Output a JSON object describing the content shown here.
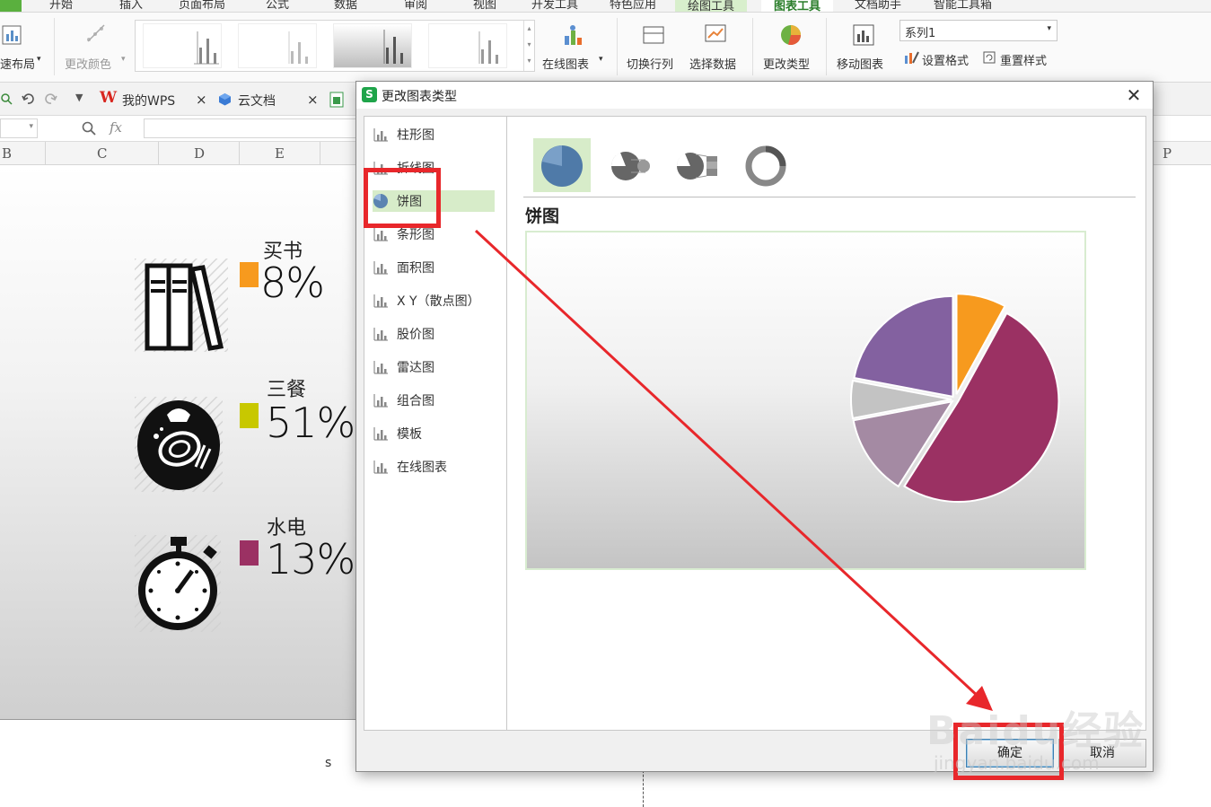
{
  "ribbon": {
    "tabs": [
      "开始",
      "插入",
      "页面布局",
      "公式",
      "数据",
      "审阅",
      "视图",
      "开发工具",
      "特色应用",
      "绘图工具",
      "图表工具",
      "文档助手",
      "智能工具箱"
    ],
    "active_tab": "图表工具",
    "quick_layout_label": "速布局",
    "change_color_label": "更改颜色",
    "online_chart_label": "在线图表",
    "switch_rowcol_label": "切换行列",
    "select_data_label": "选择数据",
    "change_type_label": "更改类型",
    "move_chart_label": "移动图表",
    "series_select_value": "系列1",
    "format_label": "设置格式",
    "reset_style_label": "重置样式"
  },
  "doc_tabs": {
    "my_wps": "我的WPS",
    "cloud_docs": "云文档"
  },
  "formula_bar": {
    "fx": "fx"
  },
  "columns": [
    "B",
    "C",
    "D",
    "E",
    "P"
  ],
  "sheet": {
    "items": [
      {
        "label": "买书",
        "percent": "8%",
        "color": "#f79a1e",
        "icon": "books-icon"
      },
      {
        "label": "三餐",
        "percent": "51%",
        "color": "#c8c800",
        "icon": "meal-icon"
      },
      {
        "label": "水电",
        "percent": "13%",
        "color": "#9b3163",
        "icon": "stopwatch-icon"
      }
    ],
    "stray_text": "s"
  },
  "dialog": {
    "title": "更改图表类型",
    "chart_types": [
      {
        "label": "柱形图",
        "icon": "bar-chart-icon"
      },
      {
        "label": "折线图",
        "icon": "line-chart-icon"
      },
      {
        "label": "饼图",
        "icon": "pie-chart-icon"
      },
      {
        "label": "条形图",
        "icon": "horizontal-bar-icon"
      },
      {
        "label": "面积图",
        "icon": "area-chart-icon"
      },
      {
        "label": "X Y（散点图）",
        "icon": "scatter-chart-icon"
      },
      {
        "label": "股价图",
        "icon": "stock-chart-icon"
      },
      {
        "label": "雷达图",
        "icon": "radar-chart-icon"
      },
      {
        "label": "组合图",
        "icon": "combo-chart-icon"
      },
      {
        "label": "模板",
        "icon": "template-icon"
      },
      {
        "label": "在线图表",
        "icon": "online-chart-icon"
      }
    ],
    "selected_type": "饼图",
    "subtypes": [
      "pie-icon",
      "exploded-pie-icon",
      "pie-of-bar-icon",
      "doughnut-icon"
    ],
    "preview_title": "饼图",
    "ok_label": "确定",
    "cancel_label": "取消"
  },
  "chart_data": {
    "type": "pie",
    "values": [
      8,
      51,
      13,
      6,
      22
    ],
    "colors": [
      "#f79a1e",
      "#9b3163",
      "#a48aa3",
      "#c3c3c3",
      "#8361a0"
    ]
  },
  "watermark": {
    "line1": "Baidu经验",
    "line2": "jingyan.baidu.com"
  }
}
